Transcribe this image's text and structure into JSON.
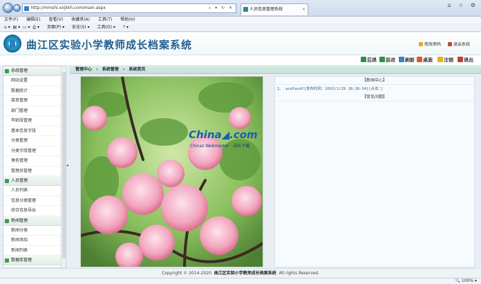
{
  "browser": {
    "url": "http://mmshi.xxjkkh.com/main.aspx",
    "tab_title": "人员信息管理系统",
    "addr_tools": "⌕ ▾ ↻ ✕",
    "menu": [
      "文件(F)",
      "编辑(E)",
      "查看(V)",
      "收藏夹(A)",
      "工具(T)",
      "帮助(H)"
    ],
    "commands": [
      "页面(P) ▾",
      "安全(S) ▾",
      "工具(O) ▾",
      "? ▾"
    ],
    "zoom": "100%"
  },
  "header": {
    "title": "曲江区实验小学教师成长档案系统",
    "change_password": "修改密码",
    "logout_system": "退出系统"
  },
  "toolbar": {
    "back": "后退",
    "forward": "前进",
    "refresh": "刷新",
    "home": "桌面",
    "logout": "注销",
    "exit": "退出"
  },
  "sidebar": {
    "groups": [
      {
        "label": "系统管理",
        "items": [
          "网站设置",
          "数据统计",
          "菜单管理",
          "部门管理",
          "年龄段管理",
          "基本信息字段",
          "分类管理",
          "分类字段管理",
          "角色管理",
          "管理员管理"
        ]
      },
      {
        "label": "人员管理",
        "items": [
          "人员列表",
          "信息分类管理",
          "综合信息导出"
        ]
      },
      {
        "label": "新闻管理",
        "items": [
          "新闻分类",
          "新闻添加",
          "新闻列表"
        ]
      },
      {
        "label": "数据库管理",
        "items": []
      }
    ]
  },
  "breadcrumb": [
    "管理中心",
    "›",
    "系统管理",
    "›",
    "系统首页"
  ],
  "watermark": {
    "title": "China◢.com",
    "sub": "Chinaz Webmaster · 站长下载"
  },
  "news": {
    "center_title": "【新闻中心】",
    "items": [
      "1、  asdfasdf[发布时间：2015/1/29 18:18:34][点击：]"
    ],
    "faq_title": "【常见问题】"
  },
  "footer": {
    "prefix": "Copyright © 2014-2020",
    "name": "曲江区实验小学教师成长档案系统",
    "suffix": "All rights Reserved."
  }
}
